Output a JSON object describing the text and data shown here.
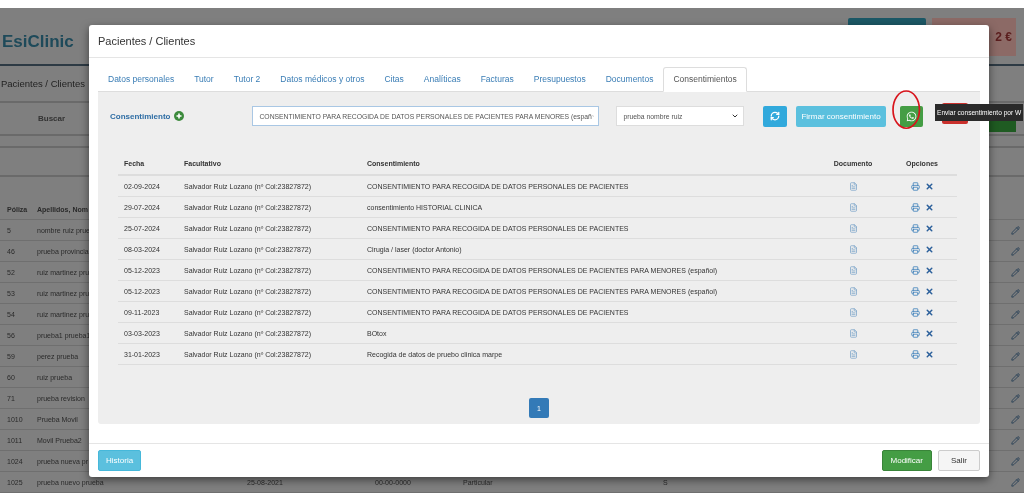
{
  "background": {
    "logo": "EsiClinic",
    "amount": "2 €",
    "page_title": "Pacientes / Clientes",
    "search_label": "Buscar",
    "table": {
      "columns": [
        "Póliza",
        "Apellidos, Nom"
      ],
      "rows": [
        {
          "poliza": "5",
          "name": "nombre ruiz prue"
        },
        {
          "poliza": "46",
          "name": "prueba provincia"
        },
        {
          "poliza": "52",
          "name": "ruiz martinez pru"
        },
        {
          "poliza": "53",
          "name": "ruiz martinez pru"
        },
        {
          "poliza": "54",
          "name": "ruiz martinez pru"
        },
        {
          "poliza": "56",
          "name": "prueba1 prueba1"
        },
        {
          "poliza": "59",
          "name": "perez prueba"
        },
        {
          "poliza": "60",
          "name": "ruiz prueba"
        },
        {
          "poliza": "71",
          "name": "prueba revision"
        },
        {
          "poliza": "1010",
          "name": "Prueba Movil"
        },
        {
          "poliza": "1011",
          "name": "Movil Prueba2"
        },
        {
          "poliza": "1024",
          "name": "prueba nueva pr"
        },
        {
          "poliza": "1025",
          "name": "prueba nuevo prueba",
          "cells": [
            "25-08-2021",
            "00-00-0000",
            "Particular",
            "S"
          ]
        }
      ]
    }
  },
  "modal": {
    "title": "Pacientes / Clientes",
    "tabs": [
      {
        "label": "Datos personales",
        "selected": false
      },
      {
        "label": "Tutor",
        "selected": false
      },
      {
        "label": "Tutor 2",
        "selected": false
      },
      {
        "label": "Datos médicos y otros",
        "selected": false
      },
      {
        "label": "Citas",
        "selected": false
      },
      {
        "label": "Analíticas",
        "selected": false
      },
      {
        "label": "Facturas",
        "selected": false
      },
      {
        "label": "Presupuestos",
        "selected": false
      },
      {
        "label": "Documentos",
        "selected": false
      },
      {
        "label": "Consentimientos",
        "selected": true
      }
    ],
    "section_title": "Consentimiento",
    "consent_select": {
      "value": "CONSENTIMIENTO PARA RECOGIDA DE DATOS PERSONALES DE PACIENTES PARA MENORES (españ"
    },
    "patient_select": {
      "value": "prueba nombre ruiz"
    },
    "sign_button": "Firmar consentimiento",
    "tooltip": "Enviar consentimiento por W",
    "table": {
      "columns": [
        "Fecha",
        "Facultativo",
        "Consentimiento",
        "Documento",
        "Opciones"
      ],
      "rows": [
        {
          "date": "02-09-2024",
          "doctor": "Salvador Ruiz Lozano (nº Col:23827872)",
          "consent": "CONSENTIMIENTO PARA RECOGIDA DE DATOS PERSONALES DE PACIENTES"
        },
        {
          "date": "29-07-2024",
          "doctor": "Salvador Ruiz Lozano (nº Col:23827872)",
          "consent": "consentimiento HISTORIAL CLINICA"
        },
        {
          "date": "25-07-2024",
          "doctor": "Salvador Ruiz Lozano (nº Col:23827872)",
          "consent": "CONSENTIMIENTO PARA RECOGIDA DE DATOS PERSONALES DE PACIENTES"
        },
        {
          "date": "08-03-2024",
          "doctor": "Salvador Ruiz Lozano (nº Col:23827872)",
          "consent": "Cirugia / laser (doctor Antonio)"
        },
        {
          "date": "05-12-2023",
          "doctor": "Salvador Ruiz Lozano (nº Col:23827872)",
          "consent": "CONSENTIMIENTO PARA RECOGIDA DE DATOS PERSONALES DE PACIENTES PARA MENORES (español)"
        },
        {
          "date": "05-12-2023",
          "doctor": "Salvador Ruiz Lozano (nº Col:23827872)",
          "consent": "CONSENTIMIENTO PARA RECOGIDA DE DATOS PERSONALES DE PACIENTES PARA MENORES (español)"
        },
        {
          "date": "09-11-2023",
          "doctor": "Salvador Ruiz Lozano (nº Col:23827872)",
          "consent": "CONSENTIMIENTO PARA RECOGIDA DE DATOS PERSONALES DE PACIENTES"
        },
        {
          "date": "03-03-2023",
          "doctor": "Salvador Ruiz Lozano (nº Col:23827872)",
          "consent": "BOtox"
        },
        {
          "date": "31-01-2023",
          "doctor": "Salvador Ruiz Lozano (nº Col:23827872)",
          "consent": "Recogida de datos de pruebo clinica marpe"
        }
      ]
    },
    "pagination": [
      {
        "label": "1",
        "selected": true
      }
    ],
    "buttons": {
      "history": "Historia",
      "modify": "Modificar",
      "exit": "Salir"
    }
  }
}
